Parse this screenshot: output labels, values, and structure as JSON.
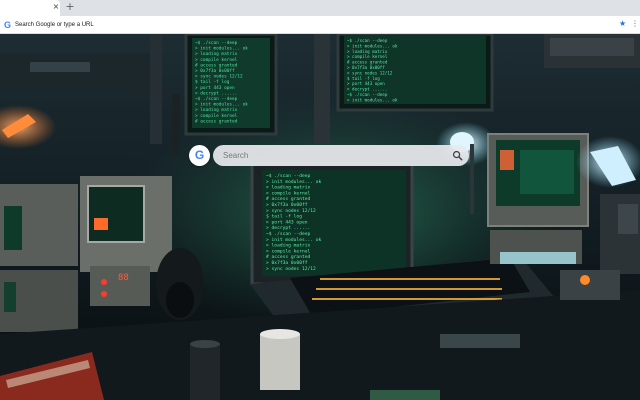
{
  "tabs": [
    {
      "close_glyph": "×"
    }
  ],
  "new_tab_glyph": "+",
  "omnibox": {
    "google_letter": "G",
    "placeholder": "Search Google or type a URL",
    "star_glyph": "★",
    "menu_glyph": "⋮"
  },
  "ntp": {
    "google_letter": "G",
    "search_placeholder": "Search"
  },
  "wallpaper": {
    "terminal_lines": [
      "~$ ./scan --deep",
      "> init modules... ok",
      "> loading matrix",
      "> compile kernel",
      "# access granted",
      "> 0x7f3a 0x00ff",
      "> sync nodes 12/12",
      "$ tail -f log",
      "> port 443 open",
      "> decrypt ......"
    ],
    "clock_readout": "88"
  },
  "colors": {
    "accent": "#1a73e8",
    "google_blue": "#4285f4",
    "terminal_green": "#36d28a",
    "neon_orange": "#ff7a2a"
  }
}
